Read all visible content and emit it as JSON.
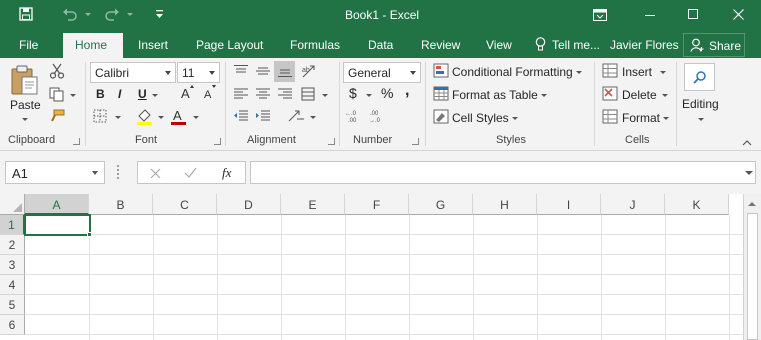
{
  "window": {
    "title": "Book1 - Excel",
    "user": "Javier Flores",
    "share_label": "Share",
    "tell_me": "Tell me..."
  },
  "tabs": [
    "File",
    "Home",
    "Insert",
    "Page Layout",
    "Formulas",
    "Data",
    "Review",
    "View"
  ],
  "active_tab": "Home",
  "ribbon": {
    "clipboard": {
      "label": "Clipboard",
      "paste": "Paste"
    },
    "font": {
      "label": "Font",
      "name": "Calibri",
      "size": "11",
      "bold": "B",
      "italic": "I",
      "underline": "U"
    },
    "alignment": {
      "label": "Alignment"
    },
    "number": {
      "label": "Number",
      "format": "General",
      "currency": "$",
      "percent": "%",
      "comma": ","
    },
    "styles": {
      "label": "Styles",
      "conditional": "Conditional Formatting",
      "table": "Format as Table",
      "cell": "Cell Styles"
    },
    "cells": {
      "label": "Cells",
      "insert": "Insert",
      "delete": "Delete",
      "format": "Format"
    },
    "editing": {
      "label": "Editing"
    }
  },
  "formula_bar": {
    "name_box": "A1",
    "fx": "fx",
    "value": ""
  },
  "grid": {
    "columns": [
      "A",
      "B",
      "C",
      "D",
      "E",
      "F",
      "G",
      "H",
      "I",
      "J",
      "K"
    ],
    "rows": [
      "1",
      "2",
      "3",
      "4",
      "5",
      "6"
    ],
    "selected_cell": "A1"
  },
  "colors": {
    "accent": "#217346",
    "font_color": "#c00000",
    "highlight": "#ffff00"
  },
  "icons": [
    "save-icon",
    "undo-icon",
    "redo-icon",
    "customize-qat-icon",
    "ribbon-display-icon",
    "minimize-icon",
    "maximize-icon",
    "close-icon",
    "lightbulb-icon",
    "person-icon",
    "paste-icon",
    "cut-icon",
    "copy-icon",
    "format-painter-icon",
    "search-icon"
  ]
}
